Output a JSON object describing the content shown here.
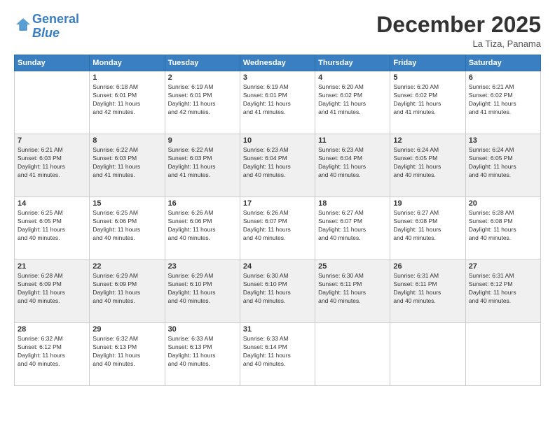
{
  "header": {
    "logo_line1": "General",
    "logo_line2": "Blue",
    "month": "December 2025",
    "location": "La Tiza, Panama"
  },
  "days_of_week": [
    "Sunday",
    "Monday",
    "Tuesday",
    "Wednesday",
    "Thursday",
    "Friday",
    "Saturday"
  ],
  "weeks": [
    [
      {
        "day": "",
        "info": ""
      },
      {
        "day": "1",
        "info": "Sunrise: 6:18 AM\nSunset: 6:01 PM\nDaylight: 11 hours\nand 42 minutes."
      },
      {
        "day": "2",
        "info": "Sunrise: 6:19 AM\nSunset: 6:01 PM\nDaylight: 11 hours\nand 42 minutes."
      },
      {
        "day": "3",
        "info": "Sunrise: 6:19 AM\nSunset: 6:01 PM\nDaylight: 11 hours\nand 41 minutes."
      },
      {
        "day": "4",
        "info": "Sunrise: 6:20 AM\nSunset: 6:02 PM\nDaylight: 11 hours\nand 41 minutes."
      },
      {
        "day": "5",
        "info": "Sunrise: 6:20 AM\nSunset: 6:02 PM\nDaylight: 11 hours\nand 41 minutes."
      },
      {
        "day": "6",
        "info": "Sunrise: 6:21 AM\nSunset: 6:02 PM\nDaylight: 11 hours\nand 41 minutes."
      }
    ],
    [
      {
        "day": "7",
        "info": "Sunrise: 6:21 AM\nSunset: 6:03 PM\nDaylight: 11 hours\nand 41 minutes."
      },
      {
        "day": "8",
        "info": "Sunrise: 6:22 AM\nSunset: 6:03 PM\nDaylight: 11 hours\nand 41 minutes."
      },
      {
        "day": "9",
        "info": "Sunrise: 6:22 AM\nSunset: 6:03 PM\nDaylight: 11 hours\nand 41 minutes."
      },
      {
        "day": "10",
        "info": "Sunrise: 6:23 AM\nSunset: 6:04 PM\nDaylight: 11 hours\nand 40 minutes."
      },
      {
        "day": "11",
        "info": "Sunrise: 6:23 AM\nSunset: 6:04 PM\nDaylight: 11 hours\nand 40 minutes."
      },
      {
        "day": "12",
        "info": "Sunrise: 6:24 AM\nSunset: 6:05 PM\nDaylight: 11 hours\nand 40 minutes."
      },
      {
        "day": "13",
        "info": "Sunrise: 6:24 AM\nSunset: 6:05 PM\nDaylight: 11 hours\nand 40 minutes."
      }
    ],
    [
      {
        "day": "14",
        "info": "Sunrise: 6:25 AM\nSunset: 6:05 PM\nDaylight: 11 hours\nand 40 minutes."
      },
      {
        "day": "15",
        "info": "Sunrise: 6:25 AM\nSunset: 6:06 PM\nDaylight: 11 hours\nand 40 minutes."
      },
      {
        "day": "16",
        "info": "Sunrise: 6:26 AM\nSunset: 6:06 PM\nDaylight: 11 hours\nand 40 minutes."
      },
      {
        "day": "17",
        "info": "Sunrise: 6:26 AM\nSunset: 6:07 PM\nDaylight: 11 hours\nand 40 minutes."
      },
      {
        "day": "18",
        "info": "Sunrise: 6:27 AM\nSunset: 6:07 PM\nDaylight: 11 hours\nand 40 minutes."
      },
      {
        "day": "19",
        "info": "Sunrise: 6:27 AM\nSunset: 6:08 PM\nDaylight: 11 hours\nand 40 minutes."
      },
      {
        "day": "20",
        "info": "Sunrise: 6:28 AM\nSunset: 6:08 PM\nDaylight: 11 hours\nand 40 minutes."
      }
    ],
    [
      {
        "day": "21",
        "info": "Sunrise: 6:28 AM\nSunset: 6:09 PM\nDaylight: 11 hours\nand 40 minutes."
      },
      {
        "day": "22",
        "info": "Sunrise: 6:29 AM\nSunset: 6:09 PM\nDaylight: 11 hours\nand 40 minutes."
      },
      {
        "day": "23",
        "info": "Sunrise: 6:29 AM\nSunset: 6:10 PM\nDaylight: 11 hours\nand 40 minutes."
      },
      {
        "day": "24",
        "info": "Sunrise: 6:30 AM\nSunset: 6:10 PM\nDaylight: 11 hours\nand 40 minutes."
      },
      {
        "day": "25",
        "info": "Sunrise: 6:30 AM\nSunset: 6:11 PM\nDaylight: 11 hours\nand 40 minutes."
      },
      {
        "day": "26",
        "info": "Sunrise: 6:31 AM\nSunset: 6:11 PM\nDaylight: 11 hours\nand 40 minutes."
      },
      {
        "day": "27",
        "info": "Sunrise: 6:31 AM\nSunset: 6:12 PM\nDaylight: 11 hours\nand 40 minutes."
      }
    ],
    [
      {
        "day": "28",
        "info": "Sunrise: 6:32 AM\nSunset: 6:12 PM\nDaylight: 11 hours\nand 40 minutes."
      },
      {
        "day": "29",
        "info": "Sunrise: 6:32 AM\nSunset: 6:13 PM\nDaylight: 11 hours\nand 40 minutes."
      },
      {
        "day": "30",
        "info": "Sunrise: 6:33 AM\nSunset: 6:13 PM\nDaylight: 11 hours\nand 40 minutes."
      },
      {
        "day": "31",
        "info": "Sunrise: 6:33 AM\nSunset: 6:14 PM\nDaylight: 11 hours\nand 40 minutes."
      },
      {
        "day": "",
        "info": ""
      },
      {
        "day": "",
        "info": ""
      },
      {
        "day": "",
        "info": ""
      }
    ]
  ]
}
